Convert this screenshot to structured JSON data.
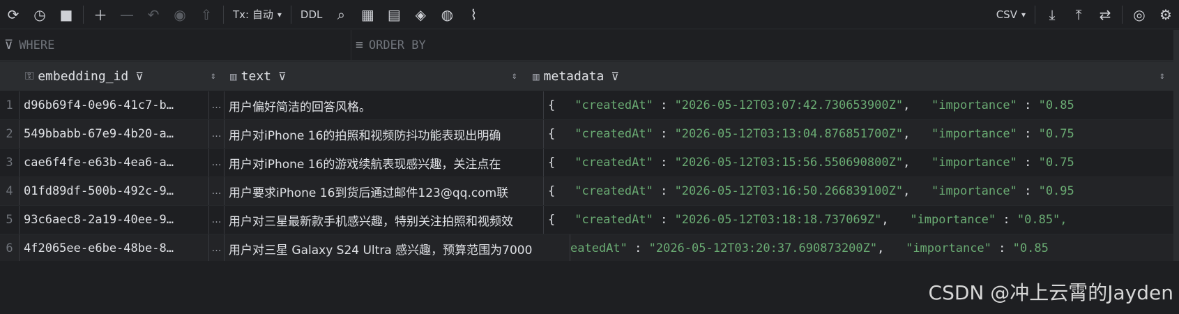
{
  "toolbar": {
    "left_icons": [
      "refresh-icon",
      "history-icon",
      "stop-icon",
      "add-row-icon",
      "remove-row-icon",
      "revert-icon",
      "preview-icon",
      "submit-icon"
    ],
    "tx_label": "Tx: 自动",
    "ddl_label": "DDL",
    "mid_icons": [
      "search-icon",
      "filter-grid-icon",
      "view-icon",
      "paint-icon",
      "globe-icon",
      "chart-icon"
    ],
    "export_format": "CSV",
    "right_icons": [
      "download-icon",
      "upload-icon",
      "compare-icon",
      "eye-icon",
      "settings-icon"
    ]
  },
  "filters": {
    "where_placeholder": "WHERE",
    "orderby_placeholder": "ORDER BY"
  },
  "columns": {
    "embedding_id": "embedding_id",
    "text": "text",
    "metadata": "metadata"
  },
  "rows": [
    {
      "n": "1",
      "id": "d96b69f4-0e96-41c7-b…",
      "gap": "…",
      "text": "用户偏好简洁的回答风格。",
      "brace": "{",
      "k1": "\"createdAt\"",
      "sep1": " : ",
      "v1": "\"2026-05-12T03:07:42.730653900Z\"",
      "sep2": ",   ",
      "k2": "\"importance\"",
      "sep3": " : ",
      "v2": "\"0.85"
    },
    {
      "n": "2",
      "id": "549bbabb-67e9-4b20-a…",
      "gap": "…",
      "text": "用户对iPhone 16的拍照和视频防抖功能表现出明确",
      "brace": "{",
      "k1": "\"createdAt\"",
      "sep1": " : ",
      "v1": "\"2026-05-12T03:13:04.876851700Z\"",
      "sep2": ",   ",
      "k2": "\"importance\"",
      "sep3": " : ",
      "v2": "\"0.75"
    },
    {
      "n": "3",
      "id": "cae6f4fe-e63b-4ea6-a…",
      "gap": "…",
      "text": "用户对iPhone 16的游戏续航表现感兴趣，关注点在",
      "brace": "{",
      "k1": "\"createdAt\"",
      "sep1": " : ",
      "v1": "\"2026-05-12T03:15:56.550690800Z\"",
      "sep2": ",   ",
      "k2": "\"importance\"",
      "sep3": " : ",
      "v2": "\"0.75"
    },
    {
      "n": "4",
      "id": "01fd89df-500b-492c-9…",
      "gap": "…",
      "text": "用户要求iPhone 16到货后通过邮件123@qq.com联",
      "brace": "{",
      "k1": "\"createdAt\"",
      "sep1": " : ",
      "v1": "\"2026-05-12T03:16:50.266839100Z\"",
      "sep2": ",   ",
      "k2": "\"importance\"",
      "sep3": " : ",
      "v2": "\"0.95"
    },
    {
      "n": "5",
      "id": "93c6aec8-2a19-40ee-9…",
      "gap": "…",
      "text": "用户对三星最新款手机感兴趣，特别关注拍照和视频效",
      "brace": "{",
      "k1": "\"createdAt\"",
      "sep1": " : ",
      "v1": "\"2026-05-12T03:18:18.737069Z\"",
      "sep2": ",   ",
      "k2": "\"importance\"",
      "sep3": " : ",
      "v2": "\"0.85\","
    },
    {
      "n": "6",
      "id": "4f2065ee-e6be-48be-8…",
      "gap": "…",
      "text": "用户对三星 Galaxy S24 Ultra 感兴趣，预算范围为7000",
      "brace": "",
      "k1": "eatedAt\"",
      "sep1": " : ",
      "v1": "\"2026-05-12T03:20:37.690873200Z\"",
      "sep2": ",   ",
      "k2": "\"importance\"",
      "sep3": " : ",
      "v2": "\"0.85"
    }
  ],
  "watermark": "CSDN @冲上云霄的Jayden"
}
